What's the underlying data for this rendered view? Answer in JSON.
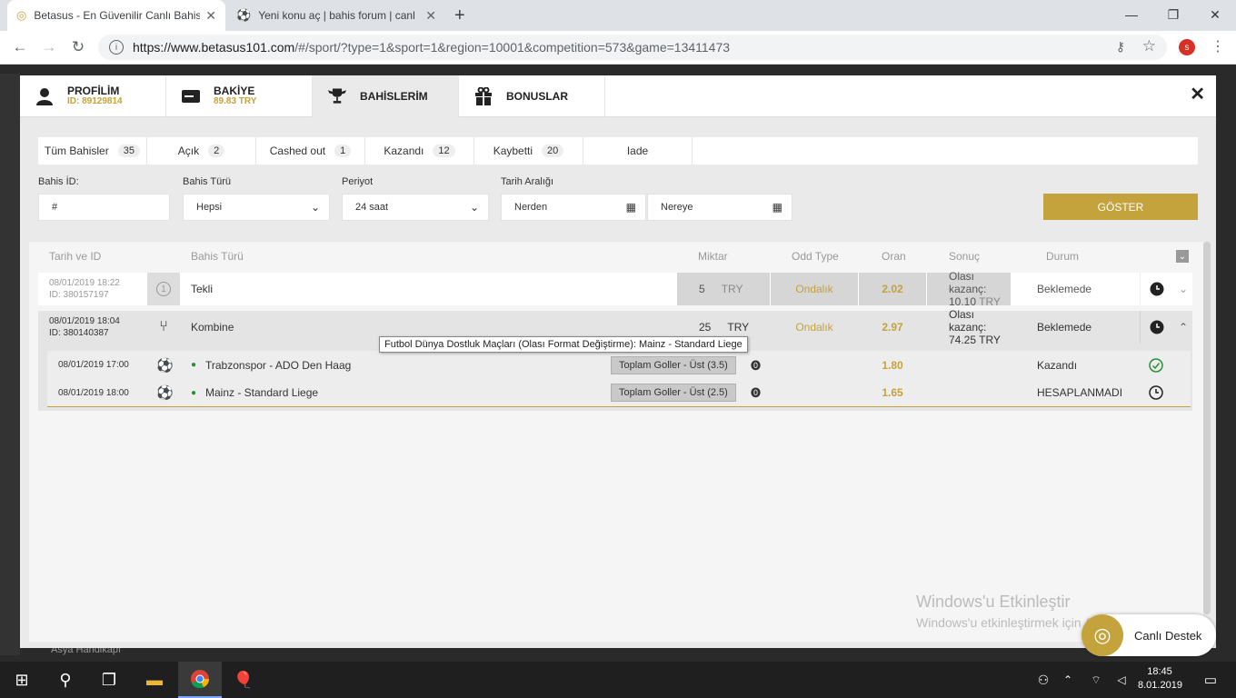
{
  "browser": {
    "tabs": [
      {
        "title": "Betasus - En Güvenilir Canlı Bahis"
      },
      {
        "title": "Yeni konu aç | bahis forum | canl"
      }
    ],
    "url_main": "https://www.betasus101.com",
    "url_rest": "/#/sport/?type=1&sport=1&region=10001&competition=573&game=13411473",
    "avatar": "s"
  },
  "modal": {
    "tabs": [
      {
        "label": "PROFİLİM",
        "sub": "ID: 89129814",
        "icon": "user-icon"
      },
      {
        "label": "BAKİYE",
        "sub": "89.83 TRY",
        "icon": "wallet-icon"
      },
      {
        "label": "BAHİSLERİM",
        "sub": "",
        "icon": "trophy-icon"
      },
      {
        "label": "BONUSLAR",
        "sub": "",
        "icon": "gift-icon"
      }
    ],
    "filter_tabs": [
      {
        "label": "Tüm Bahisler",
        "count": "35"
      },
      {
        "label": "Açık",
        "count": "2"
      },
      {
        "label": "Cashed out",
        "count": "1"
      },
      {
        "label": "Kazandı",
        "count": "12"
      },
      {
        "label": "Kaybetti",
        "count": "20"
      },
      {
        "label": "Iade",
        "count": ""
      }
    ],
    "filters": {
      "bet_id_label": "Bahis İD:",
      "bet_id_value": "#",
      "bet_type_label": "Bahis Türü",
      "bet_type_value": "Hepsi",
      "period_label": "Periyot",
      "period_value": "24 saat",
      "date_label": "Tarih Aralığı",
      "from": "Nerden",
      "to": "Nereye",
      "show_button": "GÖSTER"
    },
    "table_headers": {
      "date_id": "Tarih ve ID",
      "bet_type": "Bahis Türü",
      "amount": "Miktar",
      "odd_type": "Odd Type",
      "odds": "Oran",
      "result": "Sonuç",
      "status": "Durum"
    },
    "bets": [
      {
        "date": "08/01/2019 18:22",
        "id": "ID: 380157197",
        "type": "Tekli",
        "amount": "5",
        "currency": "TRY",
        "odd_type": "Ondalık",
        "odds": "2.02",
        "result_label": "Olası kazanç:",
        "result_value": "10.10",
        "result_cur": "TRY",
        "status": "Beklemede"
      },
      {
        "date": "08/01/2019 18:04",
        "id": "ID: 380140387",
        "type": "Kombine",
        "amount": "25",
        "currency": "TRY",
        "odd_type": "Ondalık",
        "odds": "2.97",
        "result_label": "Olası kazanç:",
        "result_value": "74.25",
        "result_cur": "TRY",
        "status": "Beklemede"
      }
    ],
    "selections": [
      {
        "date": "08/01/2019 17:00",
        "match": "Trabzonspor - ADO Den Haag",
        "market": "Toplam Goller - Üst (3.5)",
        "odds": "1.80",
        "status": "Kazandı"
      },
      {
        "date": "08/01/2019 18:00",
        "match": "Mainz - Standard Liege",
        "market": "Toplam Goller - Üst (2.5)",
        "odds": "1.65",
        "status": "HESAPLANMADI"
      }
    ],
    "tooltip": "Futbol  Dünya Dostluk Maçları (Olası Format Değiştirme): Mainz  - Standard Liege"
  },
  "bg_text": "Asya Handikapı",
  "watermark": {
    "title": "Windows'u Etkinleştir",
    "sub": "Windows'u etkinleştirmek için Ayarlar'a gidin."
  },
  "support": {
    "label": "Canlı Destek"
  },
  "taskbar": {
    "time": "18:45",
    "date": "8.01.2019"
  },
  "colors": {
    "accent": "#c4a23c"
  }
}
